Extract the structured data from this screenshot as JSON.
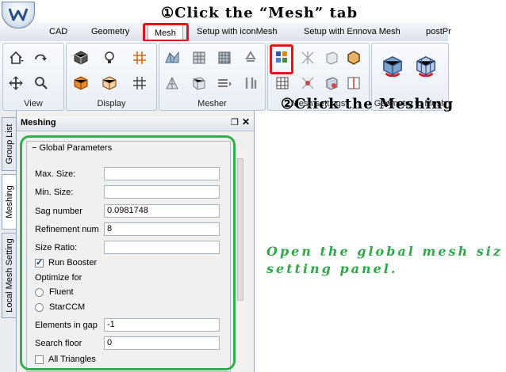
{
  "ribbon": {
    "tabs": [
      "CAD",
      "Geometry",
      "Mesh",
      "Setup with iconMesh",
      "Setup with Ennova Mesh",
      "postPr"
    ],
    "active_tab": "Mesh",
    "groups": [
      "View",
      "Display",
      "Mesher",
      "Mesh settings",
      "Geometry to Mesh"
    ]
  },
  "side_tabs": [
    "Group List",
    "Meshing",
    "Local Mesh Setting"
  ],
  "panel": {
    "title": "Meshing",
    "section": "Global Parameters",
    "fields": {
      "max_size": {
        "label": "Max. Size:",
        "value": ""
      },
      "min_size": {
        "label": "Min. Size:",
        "value": ""
      },
      "sag_number": {
        "label": "Sag number",
        "value": "0.0981748"
      },
      "refinement_num": {
        "label": "Refinement num",
        "value": "8"
      },
      "size_ratio": {
        "label": "Size Ratio:",
        "value": ""
      },
      "elements_in_gap": {
        "label": "Elements in gap",
        "value": "-1"
      },
      "search_floor": {
        "label": "Search floor",
        "value": "0"
      }
    },
    "run_booster": {
      "label": "Run Booster",
      "checked": true
    },
    "optimize_for": {
      "label": "Optimize for",
      "options": [
        "Fluent",
        "StarCCM"
      ]
    },
    "all_triangles": {
      "label": "All Triangles",
      "checked": false
    }
  },
  "annotations": {
    "step1": "①Click the “Mesh” tab",
    "step2": "②Click the Meshing",
    "note_line1": "Open the global mesh siz",
    "note_line2": "setting panel."
  },
  "colors": {
    "highlight_red": "#e0141c",
    "highlight_green": "#2fb24a",
    "note_green": "#2fa84a"
  }
}
